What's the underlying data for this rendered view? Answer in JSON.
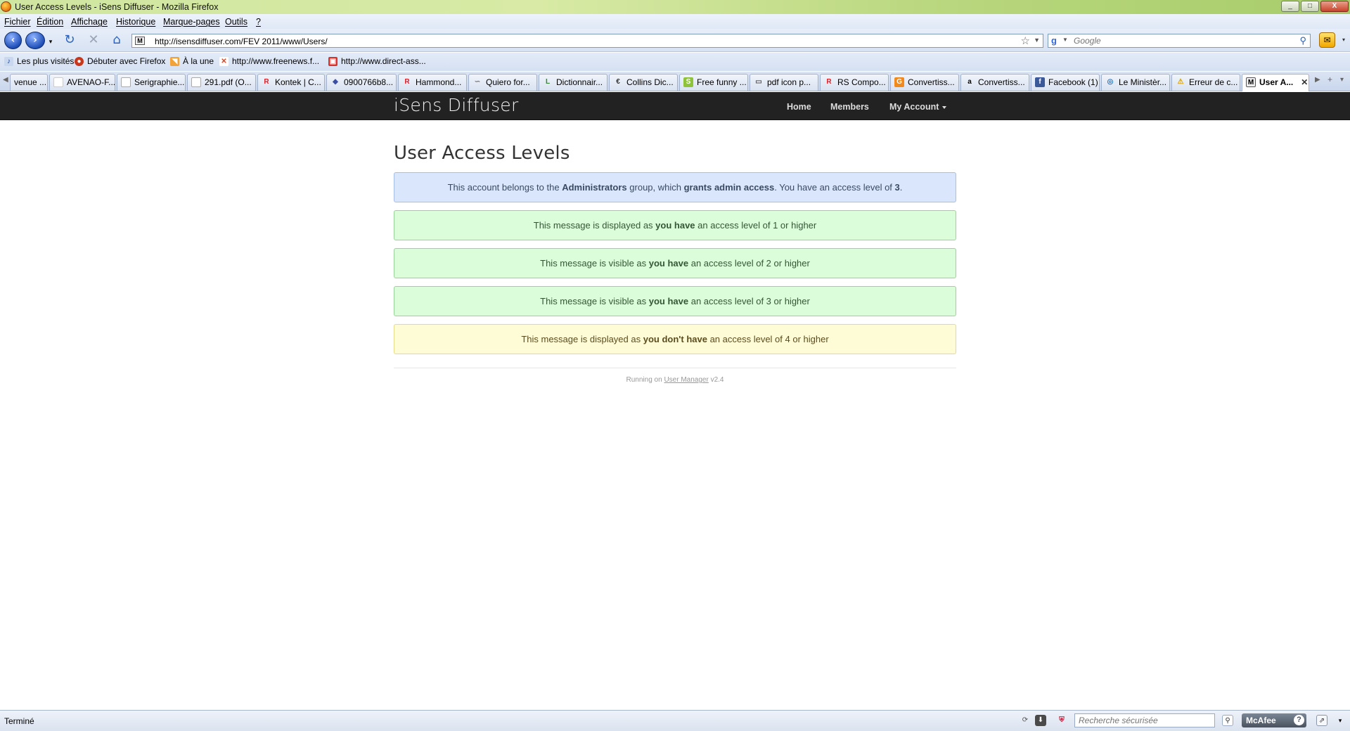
{
  "window": {
    "title": "User Access Levels - iSens Diffuser - Mozilla Firefox",
    "buttons": [
      "_",
      "□",
      "X"
    ]
  },
  "menu": [
    "Fichier",
    "Édition",
    "Affichage",
    "Historique",
    "Marque-pages",
    "Outils",
    "?"
  ],
  "navigation": {
    "url": "http://isensdiffuser.com/FEV 2011/www/Users/",
    "search_placeholder": "Google"
  },
  "bookmarks": [
    {
      "label": "Les plus visités",
      "icon": "most-visited-icon"
    },
    {
      "label": "Débuter avec Firefox",
      "icon": "firefox-icon"
    },
    {
      "label": "À la une",
      "icon": "rss-icon"
    },
    {
      "label": "http://www.freenews.f...",
      "icon": "freenews-icon"
    },
    {
      "label": "http://www.direct-ass...",
      "icon": "direct-ass-icon"
    }
  ],
  "tabs": [
    {
      "label": "venue ..."
    },
    {
      "label": "AVENAO-F..."
    },
    {
      "label": "Serigraphie..."
    },
    {
      "label": "291.pdf (O..."
    },
    {
      "label": "Kontek | C..."
    },
    {
      "label": "0900766b8..."
    },
    {
      "label": "Hammond..."
    },
    {
      "label": "Quiero for..."
    },
    {
      "label": "Dictionnair..."
    },
    {
      "label": "Collins Dic..."
    },
    {
      "label": "Free funny ..."
    },
    {
      "label": "pdf icon p..."
    },
    {
      "label": "RS Compo..."
    },
    {
      "label": "Convertiss..."
    },
    {
      "label": "Convertiss..."
    },
    {
      "label": "Facebook (1)"
    },
    {
      "label": "Le Ministèr..."
    },
    {
      "label": "Erreur de c..."
    },
    {
      "label": "User A..."
    }
  ],
  "site": {
    "brand": "iSens Diffuser",
    "nav": {
      "home": "Home",
      "members": "Members",
      "account": "My Account"
    }
  },
  "page": {
    "title": "User Access Levels",
    "info": {
      "p1": "This account belongs to the ",
      "group": "Administrators",
      "p2": " group, which ",
      "grants": "grants admin access",
      "p3": ". You have an access level of ",
      "level": "3",
      "p4": "."
    },
    "messages": [
      {
        "pre": "This message is displayed as ",
        "bold": "you have",
        "post": " an access level of 1 or higher"
      },
      {
        "pre": "This message is visible as ",
        "bold": "you have",
        "post": " an access level of 2 or higher"
      },
      {
        "pre": "This message is visible as ",
        "bold": "you have",
        "post": " an access level of 3 or higher"
      },
      {
        "pre": "This message is displayed as ",
        "bold": "you don't have",
        "post": " an access level of 4 or higher"
      }
    ],
    "footer": {
      "pre": "Running on ",
      "link": "User Manager",
      "post": " v2.4"
    }
  },
  "status": {
    "text": "Terminé",
    "secure_search_placeholder": "Recherche sécurisée",
    "mcafee": "McAfee"
  }
}
